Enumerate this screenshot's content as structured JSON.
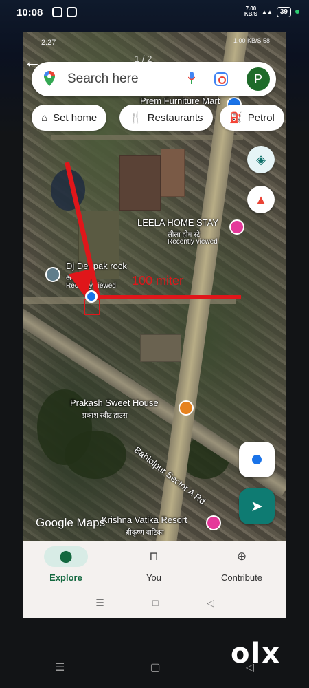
{
  "outer_status": {
    "time": "10:08",
    "speed_top": "7.00",
    "speed_bottom": "KB/S",
    "battery": "39"
  },
  "inner_status": {
    "time": "2:27",
    "right": "1.00 KB/S  58"
  },
  "pager": "1 / 2",
  "search": {
    "placeholder": "Search here",
    "avatar_letter": "P"
  },
  "chips": [
    {
      "label": "Set home",
      "icon": "home-icon"
    },
    {
      "label": "Restaurants",
      "icon": "restaurant-icon"
    },
    {
      "label": "Petrol",
      "icon": "fuel-icon"
    }
  ],
  "map_labels": {
    "prem": "Prem Furniture Mart",
    "leela": "LEELA HOME STAY",
    "leela_hi": "लीला होम स्टे",
    "recent1": "Recently viewed",
    "dj": "Dj Deepak rock",
    "dj_hi": "अवे  ो रॉक",
    "recent2": "Recently viewed",
    "distance": "100 miter",
    "prakash": "Prakash Sweet House",
    "prakash_hi": "प्रकाश स्वीट हाउस",
    "road": "Bahlolpur Sector A Rd",
    "krishna": "Krishna Vatika Resort",
    "krishna_hi": "श्रीकृष्ण वाटिका",
    "logo": "Google Maps"
  },
  "nav": [
    {
      "label": "Explore",
      "icon": "explore-pin-icon"
    },
    {
      "label": "You",
      "icon": "bookmark-icon"
    },
    {
      "label": "Contribute",
      "icon": "add-circle-icon"
    }
  ],
  "olx": [
    "o",
    "l",
    "x"
  ]
}
